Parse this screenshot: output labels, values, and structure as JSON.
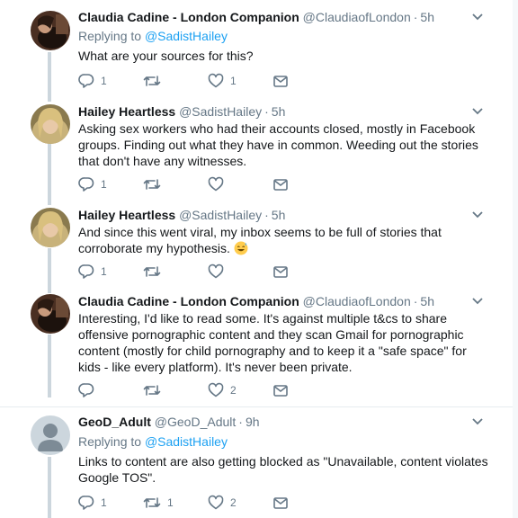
{
  "tweets": [
    {
      "name": "Claudia Cadine - London Companion",
      "handle": "@ClaudiaofLondon",
      "dot": "·",
      "time": "5h",
      "replying_prefix": "Replying to",
      "replying_to": "@SadistHailey",
      "text": "What are your sources for this?",
      "reply_count": "1",
      "retweet_count": "",
      "like_count": "1"
    },
    {
      "name": "Hailey Heartless",
      "handle": "@SadistHailey",
      "dot": "·",
      "time": "5h",
      "text": "Asking sex workers who had their accounts closed, mostly in Facebook groups. Finding out what they have in common. Weeding out the stories that don't have any witnesses.",
      "reply_count": "1",
      "retweet_count": "",
      "like_count": ""
    },
    {
      "name": "Hailey Heartless",
      "handle": "@SadistHailey",
      "dot": "·",
      "time": "5h",
      "text": "And since this went viral, my inbox seems to be full of stories that corroborate my hypothesis.",
      "emoji": "grinning-sweat-emoji",
      "reply_count": "1",
      "retweet_count": "",
      "like_count": ""
    },
    {
      "name": "Claudia Cadine - London Companion",
      "handle": "@ClaudiaofLondon",
      "dot": "·",
      "time": "5h",
      "text": "Interesting, I'd like to read some. It's against multiple t&cs to share offensive pornographic content and they scan Gmail for pornographic content (mostly for child pornography and to keep it a \"safe space\" for kids - like every platform). It's never been private.",
      "reply_count": "",
      "retweet_count": "",
      "like_count": "2"
    },
    {
      "name": "GeoD_Adult",
      "handle": "@GeoD_Adult",
      "dot": "·",
      "time": "9h",
      "replying_prefix": "Replying to",
      "replying_to": "@SadistHailey",
      "text": "Links to content are also getting blocked as \"Unavailable, content violates Google TOS\".",
      "reply_count": "1",
      "retweet_count": "1",
      "like_count": "2"
    }
  ],
  "colors": {
    "text": "#14171a",
    "secondary": "#657786",
    "link": "#1da1f2",
    "connector": "#ccd6dd",
    "divider": "#e6ecf0"
  },
  "icons": [
    "reply-icon",
    "retweet-icon",
    "like-icon",
    "direct-message-icon",
    "chevron-down-icon"
  ]
}
